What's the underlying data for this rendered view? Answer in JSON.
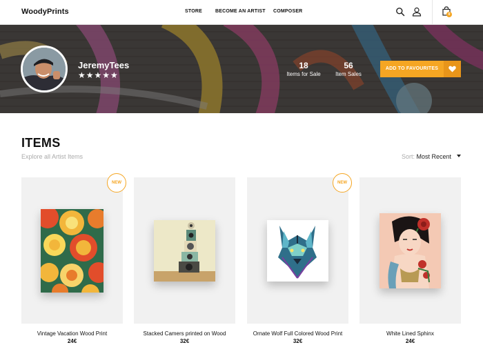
{
  "header": {
    "logo": "WoodyPrints",
    "nav": [
      "STORE",
      "BECOME AN ARTIST",
      "COMPOSER"
    ],
    "cart_count": "0",
    "icons": [
      "search-icon",
      "user-icon",
      "shopping-bag-icon"
    ]
  },
  "artist": {
    "name": "JeremyTees",
    "rating_stars": "★★★★★",
    "rating": 5,
    "items_for_sale": "18",
    "items_for_sale_label": "Items for Sale",
    "item_sales": "56",
    "item_sales_label": "Item Sales",
    "favourite_button": "ADD TO FAVOURITES"
  },
  "items_section": {
    "title": "ITEMS",
    "subtitle": "Explore all Artist Items",
    "sort_label": "Sort:",
    "sort_value": "Most Recent"
  },
  "products": [
    {
      "name": "Vintage Vacation Wood Print",
      "price": "24€",
      "badge": "NEW"
    },
    {
      "name": "Stacked Camers printed on Wood",
      "price": "32€",
      "badge": ""
    },
    {
      "name": "Ornate Wolf Full Colored Wood Print",
      "price": "32€",
      "badge": "NEW"
    },
    {
      "name": "White Lined Sphinx",
      "price": "24€",
      "badge": ""
    }
  ],
  "colors": {
    "accent": "#f5a623",
    "accent_dark": "#e8951a",
    "card_bg": "#f1f1f1",
    "muted_text": "#aaaaaa"
  }
}
